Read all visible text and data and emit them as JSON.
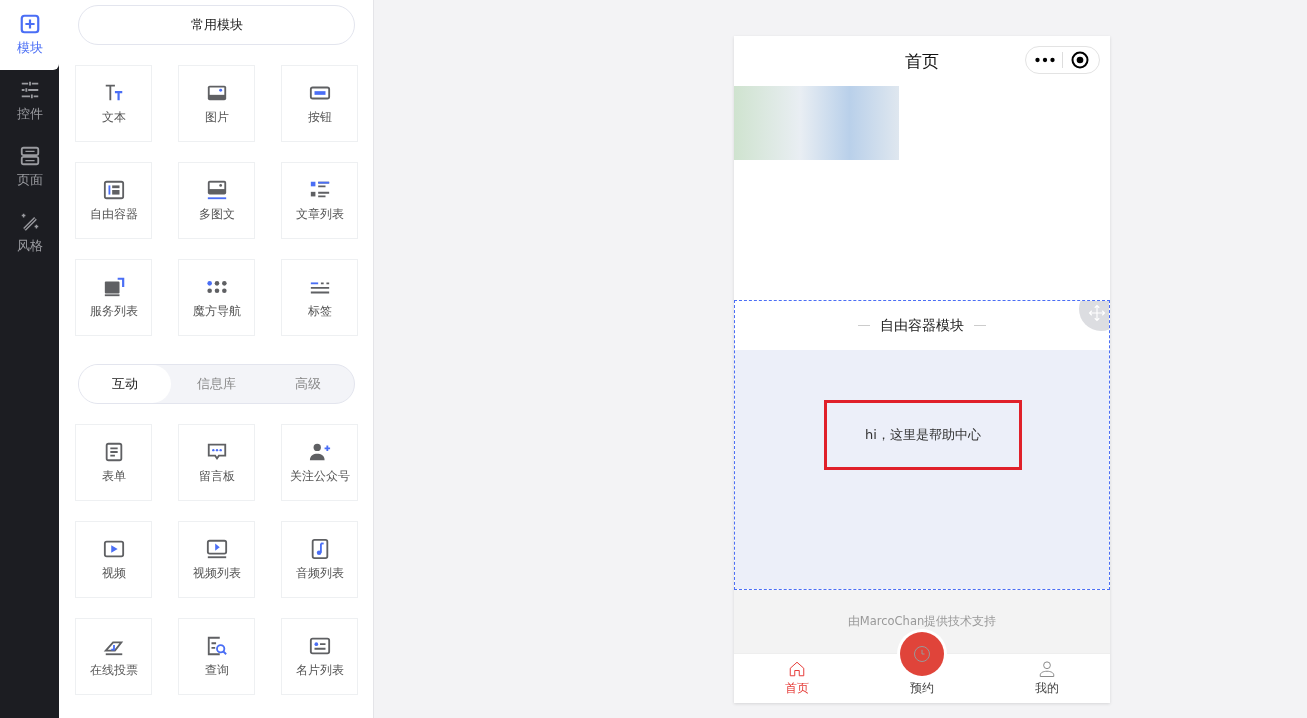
{
  "rail": [
    {
      "label": "模块",
      "selected": true
    },
    {
      "label": "控件",
      "selected": false
    },
    {
      "label": "页面",
      "selected": false
    },
    {
      "label": "风格",
      "selected": false
    }
  ],
  "common_header": "常用模块",
  "common_modules": [
    "文本",
    "图片",
    "按钮",
    "自由容器",
    "多图文",
    "文章列表",
    "服务列表",
    "魔方导航",
    "标签"
  ],
  "tabs": [
    {
      "label": "互动",
      "selected": true
    },
    {
      "label": "信息库",
      "selected": false
    },
    {
      "label": "高级",
      "selected": false
    }
  ],
  "tab_modules": [
    "表单",
    "留言板",
    "关注公众号",
    "视频",
    "视频列表",
    "音频列表",
    "在线投票",
    "查询",
    "名片列表"
  ],
  "phone": {
    "title": "首页",
    "container_title": "自由容器模块",
    "text_box": "hi，这里是帮助中心",
    "support": "由MarcoChan提供技术支持",
    "tabbar": [
      {
        "label": "首页",
        "selected": true,
        "kind": "home"
      },
      {
        "label": "预约",
        "selected": false,
        "kind": "center"
      },
      {
        "label": "我的",
        "selected": false,
        "kind": "user"
      }
    ]
  }
}
